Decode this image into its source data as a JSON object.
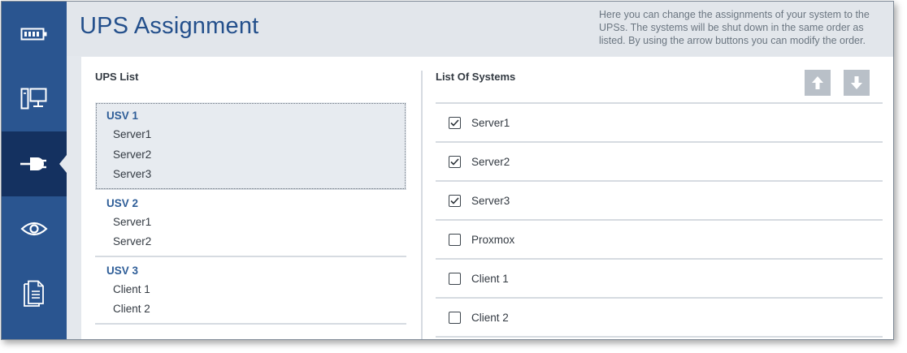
{
  "header": {
    "title": "UPS Assignment",
    "description": "Here you can change the assignments of your system to the UPSs. The systems will be shut down in the same order as listed. By using the arrow buttons you can modify the order."
  },
  "sidebar": {
    "items": [
      {
        "icon": "battery-icon",
        "active": false
      },
      {
        "icon": "computers-icon",
        "active": false
      },
      {
        "icon": "power-plug-icon",
        "active": true
      },
      {
        "icon": "eye-icon",
        "active": false
      },
      {
        "icon": "document-icon",
        "active": false
      }
    ]
  },
  "ups_list": {
    "title": "UPS List",
    "groups": [
      {
        "name": "USV 1",
        "selected": true,
        "servers": [
          "Server1",
          "Server2",
          "Server3"
        ]
      },
      {
        "name": "USV 2",
        "selected": false,
        "servers": [
          "Server1",
          "Server2"
        ]
      },
      {
        "name": "USV 3",
        "selected": false,
        "servers": [
          "Client 1",
          "Client 2"
        ]
      }
    ]
  },
  "systems": {
    "title": "List Of Systems",
    "move_up_icon": "arrow-up-icon",
    "move_down_icon": "arrow-down-icon",
    "items": [
      {
        "label": "Server1",
        "checked": true
      },
      {
        "label": "Server2",
        "checked": true
      },
      {
        "label": "Server3",
        "checked": true
      },
      {
        "label": "Proxmox",
        "checked": false
      },
      {
        "label": "Client 1",
        "checked": false
      },
      {
        "label": "Client 2",
        "checked": false
      }
    ]
  },
  "colors": {
    "sidebar": "#2a5590",
    "sidebar_active": "#143160",
    "accent": "#24508c",
    "button": "#b9c0c8"
  }
}
